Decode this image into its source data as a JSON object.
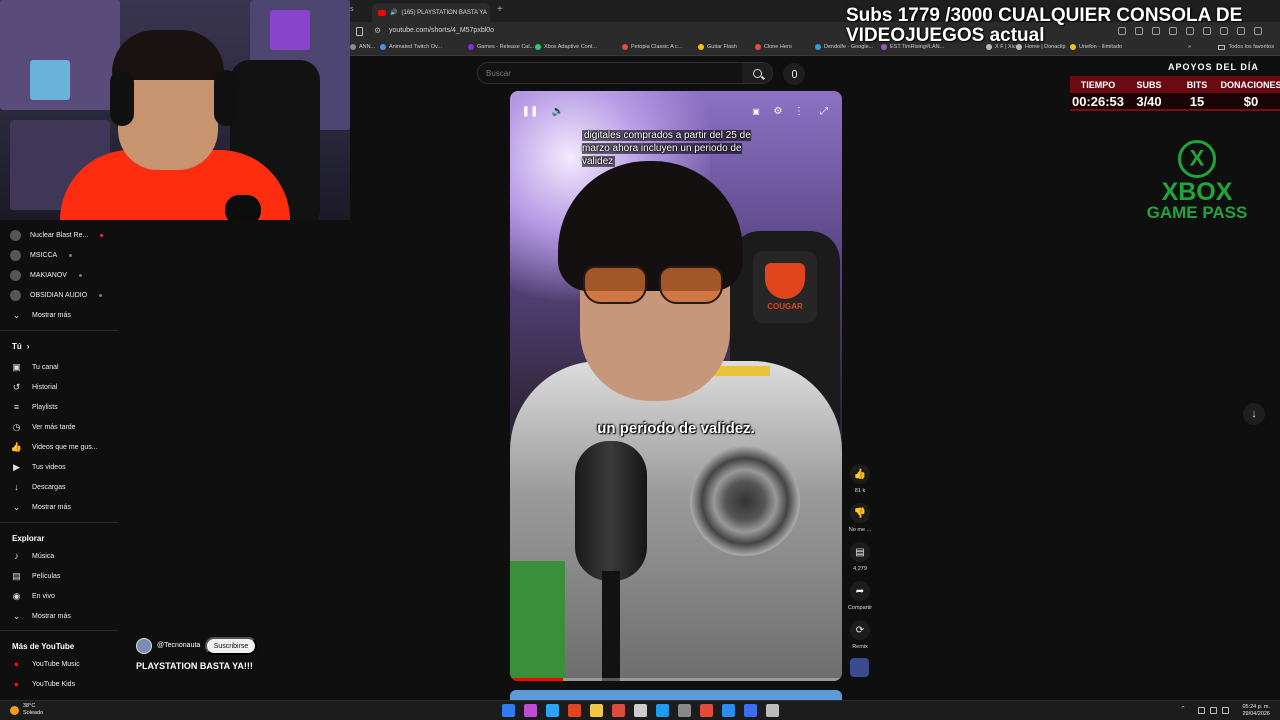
{
  "browser": {
    "tab_prev_edge": "s",
    "tab_title": "(165) PLAYSTATION BASTA YA",
    "new_tab_symbol": "+",
    "close_symbol": "×",
    "url": "youtube.com/shorts/4_M57pxbl0o",
    "bookmarks": [
      "ANN...",
      "Animated Twitch Ov...",
      "Games - Release Cal...",
      "Xbox Adaptive Cont...",
      "Petopia Classic A c...",
      "Guitar Flash",
      "Clone Hero",
      "Dendolfe - Google...",
      "EST.TimRising#LAN...",
      "X F | Xico",
      "Home | Donaclip",
      "Unefon - Ilimitado"
    ],
    "bookmark_colors": [
      "#888888",
      "#4a90e2",
      "#8a2be2",
      "#2ecc71",
      "#e74c3c",
      "#f1c40f",
      "#e74c3c",
      "#3498db",
      "#9b59b6",
      "#bbbbbb",
      "#bbbbbb",
      "#f1c40f"
    ],
    "more_bookmarks": "»",
    "all_favorites": "Todos los favoritos"
  },
  "overlay": {
    "subs_line1": "Subs 1779 /3000 CUALQUIER CONSOLA DE",
    "subs_line2": "VIDEOJUEGOS actual",
    "apoyos_title": "APOYOS DEL DÍA",
    "columns": [
      "TIEMPO",
      "SUBS",
      "BITS",
      "DONACIONES"
    ],
    "values": [
      "00:26:53",
      "3/40",
      "15",
      "$0"
    ],
    "xbox_line1": "XBOX",
    "xbox_line2": "GAME PASS",
    "xbox_logo": "X"
  },
  "search": {
    "placeholder": "Buscar"
  },
  "sidebar": {
    "subscriptions": [
      {
        "label": "Nuclear Blast Re...",
        "live": true
      },
      {
        "label": "MSICCA",
        "live": false
      },
      {
        "label": "MAKIANOV",
        "live": false
      },
      {
        "label": "OBSIDIAN AUDIO",
        "live": false
      }
    ],
    "show_more": "Mostrar más",
    "you_heading": "Tú",
    "you_arrow": "›",
    "you_items": [
      {
        "label": "Tu canal",
        "icon": "user-square-icon"
      },
      {
        "label": "Historial",
        "icon": "history-icon"
      },
      {
        "label": "Playlists",
        "icon": "playlist-icon"
      },
      {
        "label": "Ver más tarde",
        "icon": "clock-icon"
      },
      {
        "label": "Videos que me gus...",
        "icon": "thumb-up-icon"
      },
      {
        "label": "Tus videos",
        "icon": "video-square-icon"
      },
      {
        "label": "Descargas",
        "icon": "download-icon"
      }
    ],
    "explore_heading": "Explorar",
    "explore_items": [
      {
        "label": "Música",
        "icon": "music-note-icon"
      },
      {
        "label": "Películas",
        "icon": "film-icon"
      },
      {
        "label": "En vivo",
        "icon": "live-broadcast-icon"
      }
    ],
    "more_yt_heading": "Más de YouTube",
    "more_yt_items": [
      {
        "label": "YouTube Music",
        "icon": "youtube-music-icon"
      },
      {
        "label": "YouTube Kids",
        "icon": "youtube-kids-icon"
      }
    ]
  },
  "video": {
    "caption_top": "digitales comprados a partir del 25 de marzo ahora incluyen un periodo de validez",
    "subtitle": "un periodo de validez.",
    "progress": 0.16,
    "brand_on_chair": "COUGAR"
  },
  "actions": [
    {
      "name": "like",
      "icon": "thumb-up-icon",
      "label": "81 k"
    },
    {
      "name": "dislike",
      "icon": "thumb-down-icon",
      "label": "No me ..."
    },
    {
      "name": "comments",
      "icon": "comment-icon",
      "label": "4,279"
    },
    {
      "name": "share",
      "icon": "share-icon",
      "label": "Compartir"
    },
    {
      "name": "remix",
      "icon": "remix-icon",
      "label": "Remix"
    }
  ],
  "channel": {
    "name": "@Tecnonauta",
    "subscribe": "Suscribirse",
    "title": "PLAYSTATION BASTA YA!!!"
  },
  "taskbar": {
    "temp": "38°C",
    "weather": "Soleado",
    "time": "05:24 p. m.",
    "date": "29/04/2026",
    "apps": [
      "#2f7bf5",
      "#c04cd4",
      "#2aa4f4",
      "#e0451d",
      "#f2c744",
      "#e04a3a",
      "#cccccc",
      "#1b9cf2",
      "#888888",
      "#e24a3b",
      "#2e8bf0",
      "#3a6df0",
      "#bbbbbb"
    ]
  }
}
